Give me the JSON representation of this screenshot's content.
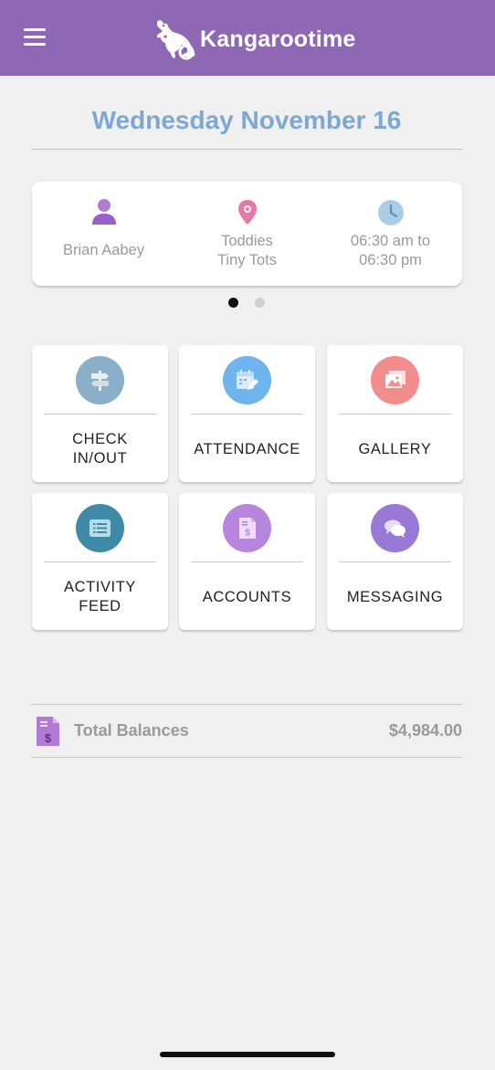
{
  "app": {
    "name": "Kangarootime"
  },
  "colors": {
    "header": "#8e68b4",
    "date": "#7ea8d2",
    "person_icon": "#b07bd4",
    "location_icon": "#e879a6",
    "clock_icon": "#a9cde6",
    "dot_active": "#111111",
    "dot_inactive": "#d0d0d0"
  },
  "date": "Wednesday November 16",
  "info": {
    "person": {
      "name": "Brian Aabey",
      "icon": "person-icon"
    },
    "location": {
      "line1": "Toddies",
      "line2": "Tiny Tots",
      "icon": "location-pin-icon"
    },
    "hours": {
      "line1": "06:30 am to",
      "line2": "06:30 pm",
      "icon": "clock-icon"
    }
  },
  "carousel": {
    "pages": 2,
    "active": 1
  },
  "tiles": [
    {
      "label": "CHECK\nIN/OUT",
      "icon": "signpost-icon",
      "color": "#8aafc9"
    },
    {
      "label": "ATTENDANCE",
      "icon": "calendar-edit-icon",
      "color": "#6fb4ec"
    },
    {
      "label": "GALLERY",
      "icon": "gallery-icon",
      "color": "#f28d8d"
    },
    {
      "label": "ACTIVITY\nFEED",
      "icon": "list-icon",
      "color": "#3f8aa6"
    },
    {
      "label": "ACCOUNTS",
      "icon": "invoice-icon",
      "color": "#b785dc"
    },
    {
      "label": "MESSAGING",
      "icon": "chat-bubbles-icon",
      "color": "#9a78d6"
    }
  ],
  "balance": {
    "label": "Total Balances",
    "value": "$4,984.00",
    "icon": "invoice-icon"
  }
}
